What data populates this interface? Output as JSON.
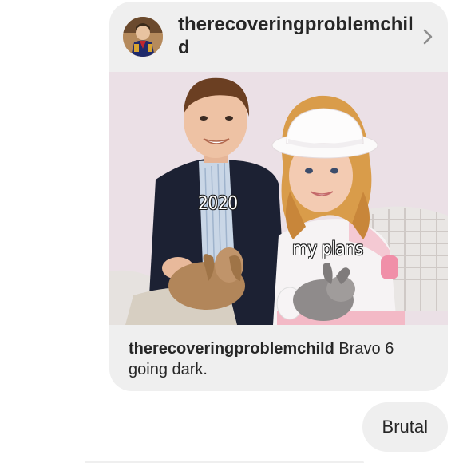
{
  "shared_post": {
    "username": "therecoveringproblemchild",
    "avatar_icon": "profile-avatar",
    "chevron_icon": "chevron-right-icon",
    "meme": {
      "label_1": "2020",
      "label_2": "my plans"
    },
    "caption": {
      "username": "therecoveringproblemchild",
      "text": "Bravo 6 going dark."
    }
  },
  "messages": [
    {
      "text": "Brutal",
      "direction": "outgoing"
    }
  ],
  "colors": {
    "bubble": "#efefef",
    "text": "#262626",
    "background": "#ffffff"
  }
}
